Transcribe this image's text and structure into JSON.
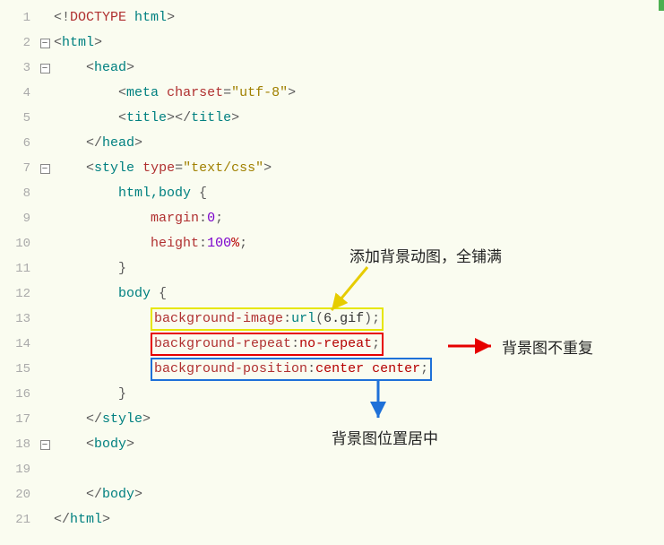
{
  "lines": [
    {
      "n": "1",
      "fold": ""
    },
    {
      "n": "2",
      "fold": "minus"
    },
    {
      "n": "3",
      "fold": "minus"
    },
    {
      "n": "4",
      "fold": ""
    },
    {
      "n": "5",
      "fold": ""
    },
    {
      "n": "6",
      "fold": ""
    },
    {
      "n": "7",
      "fold": "minus"
    },
    {
      "n": "8",
      "fold": ""
    },
    {
      "n": "9",
      "fold": ""
    },
    {
      "n": "10",
      "fold": ""
    },
    {
      "n": "11",
      "fold": ""
    },
    {
      "n": "12",
      "fold": ""
    },
    {
      "n": "13",
      "fold": ""
    },
    {
      "n": "14",
      "fold": ""
    },
    {
      "n": "15",
      "fold": ""
    },
    {
      "n": "16",
      "fold": ""
    },
    {
      "n": "17",
      "fold": ""
    },
    {
      "n": "18",
      "fold": "minus"
    },
    {
      "n": "19",
      "fold": ""
    },
    {
      "n": "20",
      "fold": ""
    },
    {
      "n": "21",
      "fold": ""
    }
  ],
  "code": {
    "doctype_open": "<!",
    "doctype": "DOCTYPE",
    "html_kw": "html",
    "doctype_close": ">",
    "lt": "<",
    "gt": ">",
    "lts": "</",
    "html": "html",
    "head": "head",
    "meta": "meta",
    "title": "title",
    "style": "style",
    "body": "body",
    "charset_attr": "charset",
    "charset_val": "\"utf-8\"",
    "type_attr": "type",
    "type_val": "\"text/css\"",
    "sel_htmlbody": "html,body",
    "sel_body": "body",
    "brace_open": "{",
    "brace_close": "}",
    "margin": "margin",
    "zero": "0",
    "height": "height",
    "hundred": "100",
    "pct": "%",
    "bg_image": "background-image",
    "url_func": "url",
    "url_arg": "6.gif",
    "bg_repeat": "background-repeat",
    "no_repeat": "no-repeat",
    "bg_pos": "background-position",
    "center": "center",
    "semi": ";",
    "colon": ":",
    "paren_open": "(",
    "paren_close": ")"
  },
  "annotations": {
    "yellow": "添加背景动图，全铺满",
    "red": "背景图不重复",
    "blue": "背景图位置居中"
  }
}
